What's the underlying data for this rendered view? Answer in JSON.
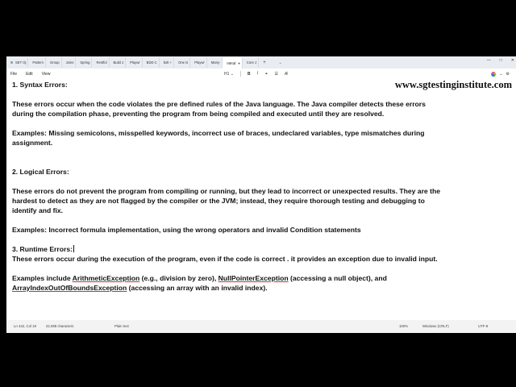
{
  "tabs": [
    {
      "label": "SET Oj"
    },
    {
      "label": "Pattern"
    },
    {
      "label": "Group"
    },
    {
      "label": "Joins"
    },
    {
      "label": "Spring"
    },
    {
      "label": "Restful"
    },
    {
      "label": "Build J"
    },
    {
      "label": "Playwr"
    },
    {
      "label": "BDD C"
    },
    {
      "label": "bolt +"
    },
    {
      "label": "One is"
    },
    {
      "label": "Playwr"
    },
    {
      "label": "Many-"
    },
    {
      "label": "Introd",
      "active": true
    },
    {
      "label": "Core J"
    }
  ],
  "tab_add": "+",
  "tab_dropdown": "⌄",
  "window_controls": {
    "minimize": "—",
    "maximize": "□",
    "close": "✕"
  },
  "menu": {
    "file": "File",
    "edit": "Edit",
    "view": "View"
  },
  "toolbar": {
    "heading": "H1",
    "heading_caret": "⌄",
    "bold": "B",
    "italic": "I",
    "link": "⚭",
    "list": "☰",
    "clear": "A̸"
  },
  "right_tools": {
    "more": "⌄",
    "settings": "⚙"
  },
  "watermark": "www.sgtestinginstitute.com",
  "document": {
    "line1": "1. Syntax Errors:",
    "line2": "These errors occur when the code violates the pre defined rules of the Java language. The Java compiler detects these errors",
    "line3": "during the compilation phase, preventing the program from being compiled and executed until they are resolved.",
    "line4": "Examples: Missing semicolons, misspelled keywords, incorrect use of braces, undeclared variables, type mismatches during",
    "line5": "assignment.",
    "line6": "2. Logical Errors:",
    "line7": "These errors do not prevent the program from compiling or running, but they lead to incorrect or unexpected results. They are the",
    "line8": "hardest to detect as they are not flagged by the compiler or the JVM; instead, they require thorough testing and debugging to",
    "line9": "identify and fix.",
    "line10": "Examples: Incorrect formula implementation, using the wrong operators and invalid Condition statements",
    "line11": "3. Runtime Errors:",
    "line12": "These errors occur during the execution of the program, even if the code is correct . it provides an exception due to invalid input.",
    "line13_a": "Examples include ",
    "line13_b": "ArithmeticException",
    "line13_c": " (e.g., division by zero), ",
    "line13_d": "NullPointerException",
    "line13_e": " (accessing a null object), and",
    "line14_a": "ArrayIndexOutOfBoundsException",
    "line14_b": " (accessing an array with an invalid index)."
  },
  "status": {
    "position": "Ln 442, Col 19",
    "characters": "22,088 characters",
    "format": "Plain text",
    "zoom": "100%",
    "line_ending": "Windows (CRLF)",
    "encoding": "UTF-8"
  }
}
